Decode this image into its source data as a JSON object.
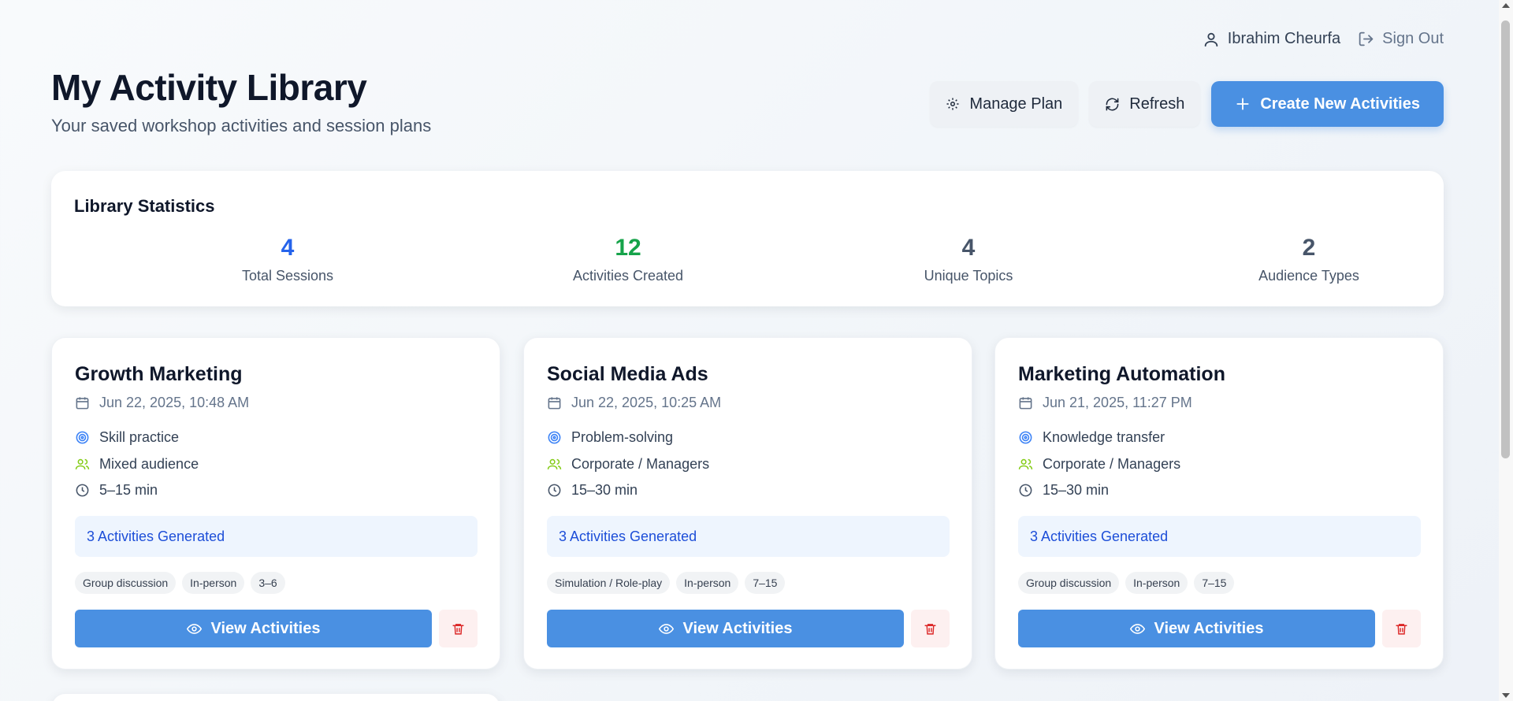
{
  "user": {
    "name": "Ibrahim Cheurfa",
    "sign_out": "Sign Out"
  },
  "header": {
    "title": "My Activity Library",
    "subtitle": "Your saved workshop activities and session plans",
    "manage_plan": "Manage Plan",
    "refresh": "Refresh",
    "create": "Create New Activities"
  },
  "stats": {
    "title": "Library Statistics",
    "items": [
      {
        "value": "4",
        "label": "Total Sessions",
        "color": "#2563eb"
      },
      {
        "value": "12",
        "label": "Activities Created",
        "color": "#16a34a"
      },
      {
        "value": "4",
        "label": "Unique Topics",
        "color": "#475569"
      },
      {
        "value": "2",
        "label": "Audience Types",
        "color": "#475569"
      }
    ]
  },
  "sessions": [
    {
      "title": "Growth Marketing",
      "date": "Jun 22, 2025, 10:48 AM",
      "goal": "Skill practice",
      "audience": "Mixed audience",
      "duration": "5–15 min",
      "generated": "3 Activities Generated",
      "tags": [
        "Group discussion",
        "In-person",
        "3–6"
      ],
      "view_label": "View Activities"
    },
    {
      "title": "Social Media Ads",
      "date": "Jun 22, 2025, 10:25 AM",
      "goal": "Problem-solving",
      "audience": "Corporate / Managers",
      "duration": "15–30 min",
      "generated": "3 Activities Generated",
      "tags": [
        "Simulation / Role-play",
        "In-person",
        "7–15"
      ],
      "view_label": "View Activities"
    },
    {
      "title": "Marketing Automation",
      "date": "Jun 21, 2025, 11:27 PM",
      "goal": "Knowledge transfer",
      "audience": "Corporate / Managers",
      "duration": "15–30 min",
      "generated": "3 Activities Generated",
      "tags": [
        "Group discussion",
        "In-person",
        "7–15"
      ],
      "view_label": "View Activities"
    }
  ],
  "icons": {
    "user": "user-icon",
    "signout": "sign-out-icon",
    "gear": "gear-icon",
    "refresh": "refresh-icon",
    "plus": "plus-icon",
    "calendar": "calendar-icon",
    "target": "target-icon",
    "users": "users-icon",
    "clock": "clock-icon",
    "eye": "eye-icon",
    "trash": "trash-icon"
  },
  "colors": {
    "accent": "#4a90e2",
    "target": "#3b82f6",
    "users": "#84cc16",
    "danger": "#dc2626"
  }
}
